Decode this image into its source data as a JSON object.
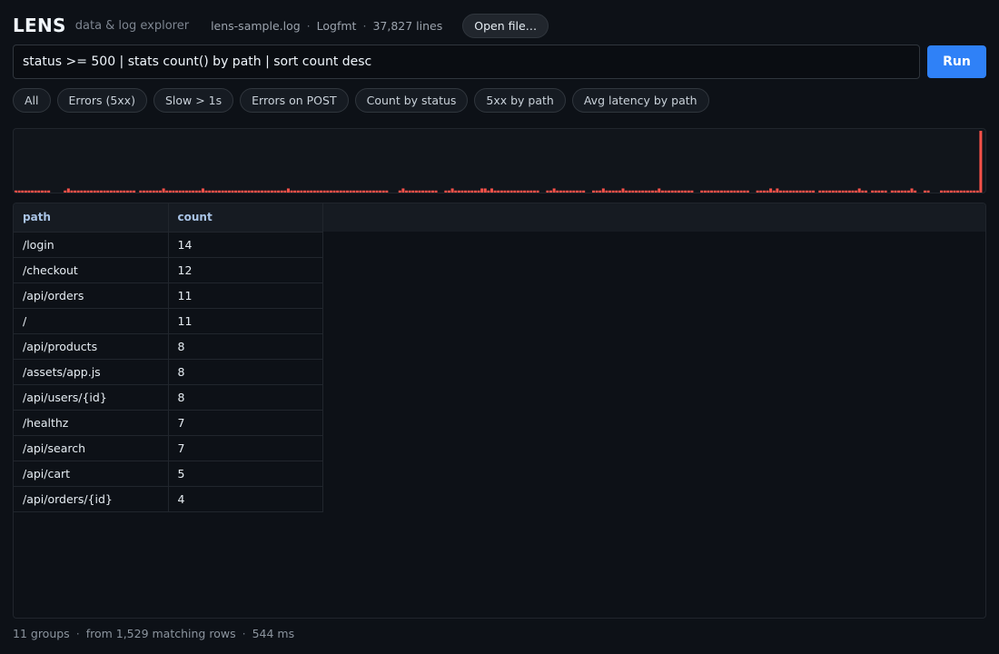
{
  "app": {
    "name": "LENS",
    "tagline": "data & log explorer"
  },
  "file": {
    "name": "lens-sample.log",
    "format": "Logfmt",
    "lines": "37,827 lines",
    "open_label": "Open file…"
  },
  "query": {
    "value": "status >= 500 | stats count() by path | sort count desc",
    "run_label": "Run"
  },
  "presets": [
    "All",
    "Errors (5xx)",
    "Slow > 1s",
    "Errors on POST",
    "Count by status",
    "5xx by path",
    "Avg latency by path"
  ],
  "histogram": {
    "bar_color": "#f85149",
    "values": [
      1,
      1,
      1,
      1,
      1,
      1,
      1,
      1,
      1,
      1,
      1,
      0,
      0,
      0,
      0,
      1,
      2,
      1,
      1,
      1,
      1,
      1,
      1,
      1,
      1,
      1,
      1,
      1,
      1,
      1,
      1,
      1,
      1,
      1,
      1,
      1,
      1,
      0,
      1,
      1,
      1,
      1,
      1,
      1,
      1,
      2,
      1,
      1,
      1,
      1,
      1,
      1,
      1,
      1,
      1,
      1,
      1,
      2,
      1,
      1,
      1,
      1,
      1,
      1,
      1,
      1,
      1,
      1,
      1,
      1,
      1,
      1,
      1,
      1,
      1,
      1,
      1,
      1,
      1,
      1,
      1,
      1,
      1,
      2,
      1,
      1,
      1,
      1,
      1,
      1,
      1,
      1,
      1,
      1,
      1,
      1,
      1,
      1,
      1,
      1,
      1,
      1,
      1,
      1,
      1,
      1,
      1,
      1,
      1,
      1,
      1,
      1,
      1,
      1,
      0,
      0,
      0,
      1,
      2,
      1,
      1,
      1,
      1,
      1,
      1,
      1,
      1,
      1,
      1,
      0,
      0,
      1,
      1,
      2,
      1,
      1,
      1,
      1,
      1,
      1,
      1,
      1,
      2,
      2,
      1,
      2,
      1,
      1,
      1,
      1,
      1,
      1,
      1,
      1,
      1,
      1,
      1,
      1,
      1,
      1,
      0,
      0,
      1,
      1,
      2,
      1,
      1,
      1,
      1,
      1,
      1,
      1,
      1,
      1,
      0,
      0,
      1,
      1,
      1,
      2,
      1,
      1,
      1,
      1,
      1,
      2,
      1,
      1,
      1,
      1,
      1,
      1,
      1,
      1,
      1,
      1,
      2,
      1,
      1,
      1,
      1,
      1,
      1,
      1,
      1,
      1,
      1,
      0,
      0,
      1,
      1,
      1,
      1,
      1,
      1,
      1,
      1,
      1,
      1,
      1,
      1,
      1,
      1,
      1,
      0,
      0,
      1,
      1,
      1,
      1,
      2,
      1,
      2,
      1,
      1,
      1,
      1,
      1,
      1,
      1,
      1,
      1,
      1,
      1,
      0,
      1,
      1,
      1,
      1,
      1,
      1,
      1,
      1,
      1,
      1,
      1,
      1,
      2,
      1,
      1,
      0,
      1,
      1,
      1,
      1,
      1,
      0,
      1,
      1,
      1,
      1,
      1,
      1,
      2,
      1,
      0,
      0,
      1,
      1,
      0,
      0,
      0,
      1,
      1,
      1,
      1,
      1,
      1,
      1,
      1,
      1,
      1,
      1,
      1,
      30
    ]
  },
  "results": {
    "columns": [
      "path",
      "count"
    ],
    "rows": [
      [
        "/login",
        "14"
      ],
      [
        "/checkout",
        "12"
      ],
      [
        "/api/orders",
        "11"
      ],
      [
        "/",
        "11"
      ],
      [
        "/api/products",
        "8"
      ],
      [
        "/assets/app.js",
        "8"
      ],
      [
        "/api/users/{id}",
        "8"
      ],
      [
        "/healthz",
        "7"
      ],
      [
        "/api/search",
        "7"
      ],
      [
        "/api/cart",
        "5"
      ],
      [
        "/api/orders/{id}",
        "4"
      ]
    ]
  },
  "status": {
    "groups": "11 groups",
    "matching": "from 1,529 matching rows",
    "time": "544 ms"
  }
}
